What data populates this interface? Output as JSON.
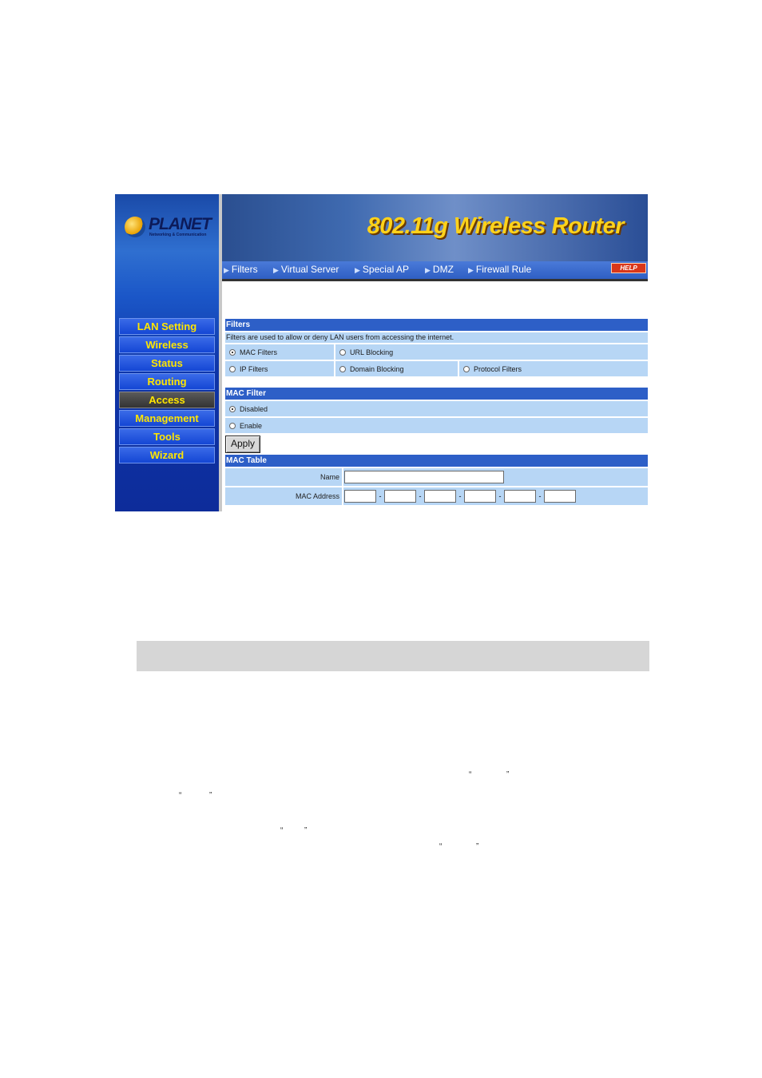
{
  "brand": {
    "logo": "PLANET",
    "tagline": "Networking & Communication"
  },
  "banner": {
    "title": "802.11g Wireless Router"
  },
  "tabs": [
    "Filters",
    "Virtual Server",
    "Special AP",
    "DMZ",
    "Firewall Rule"
  ],
  "help_label": "HELP",
  "sidebar": {
    "items": [
      {
        "label": "LAN Setting"
      },
      {
        "label": "Wireless"
      },
      {
        "label": "Status"
      },
      {
        "label": "Routing"
      },
      {
        "label": "Access",
        "active": true
      },
      {
        "label": "Management"
      },
      {
        "label": "Tools"
      },
      {
        "label": "Wizard"
      }
    ]
  },
  "filters": {
    "header": "Filters",
    "description": "Filters are used to allow or deny LAN users from accessing the internet.",
    "options": {
      "mac": "MAC Filters",
      "url": "URL Blocking",
      "ip": "IP Filters",
      "domain": "Domain Blocking",
      "protocol": "Protocol Filters"
    },
    "selected": "MAC Filters"
  },
  "mac_filter": {
    "header": "MAC Filter",
    "disabled_label": "Disabled",
    "enable_label": "Enable",
    "selected": "Disabled"
  },
  "apply_label": "Apply",
  "mac_table": {
    "header": "MAC Table",
    "name_label": "Name",
    "name_value": "",
    "mac_label": "MAC Address",
    "separator": "-"
  },
  "quote_open": "“",
  "quote_close": "”",
  "colors": {
    "accent_blue": "#2d5fc7",
    "row_blue": "#b7d6f5",
    "nav_text": "#ffe600",
    "banner_title": "#ffd21a"
  }
}
